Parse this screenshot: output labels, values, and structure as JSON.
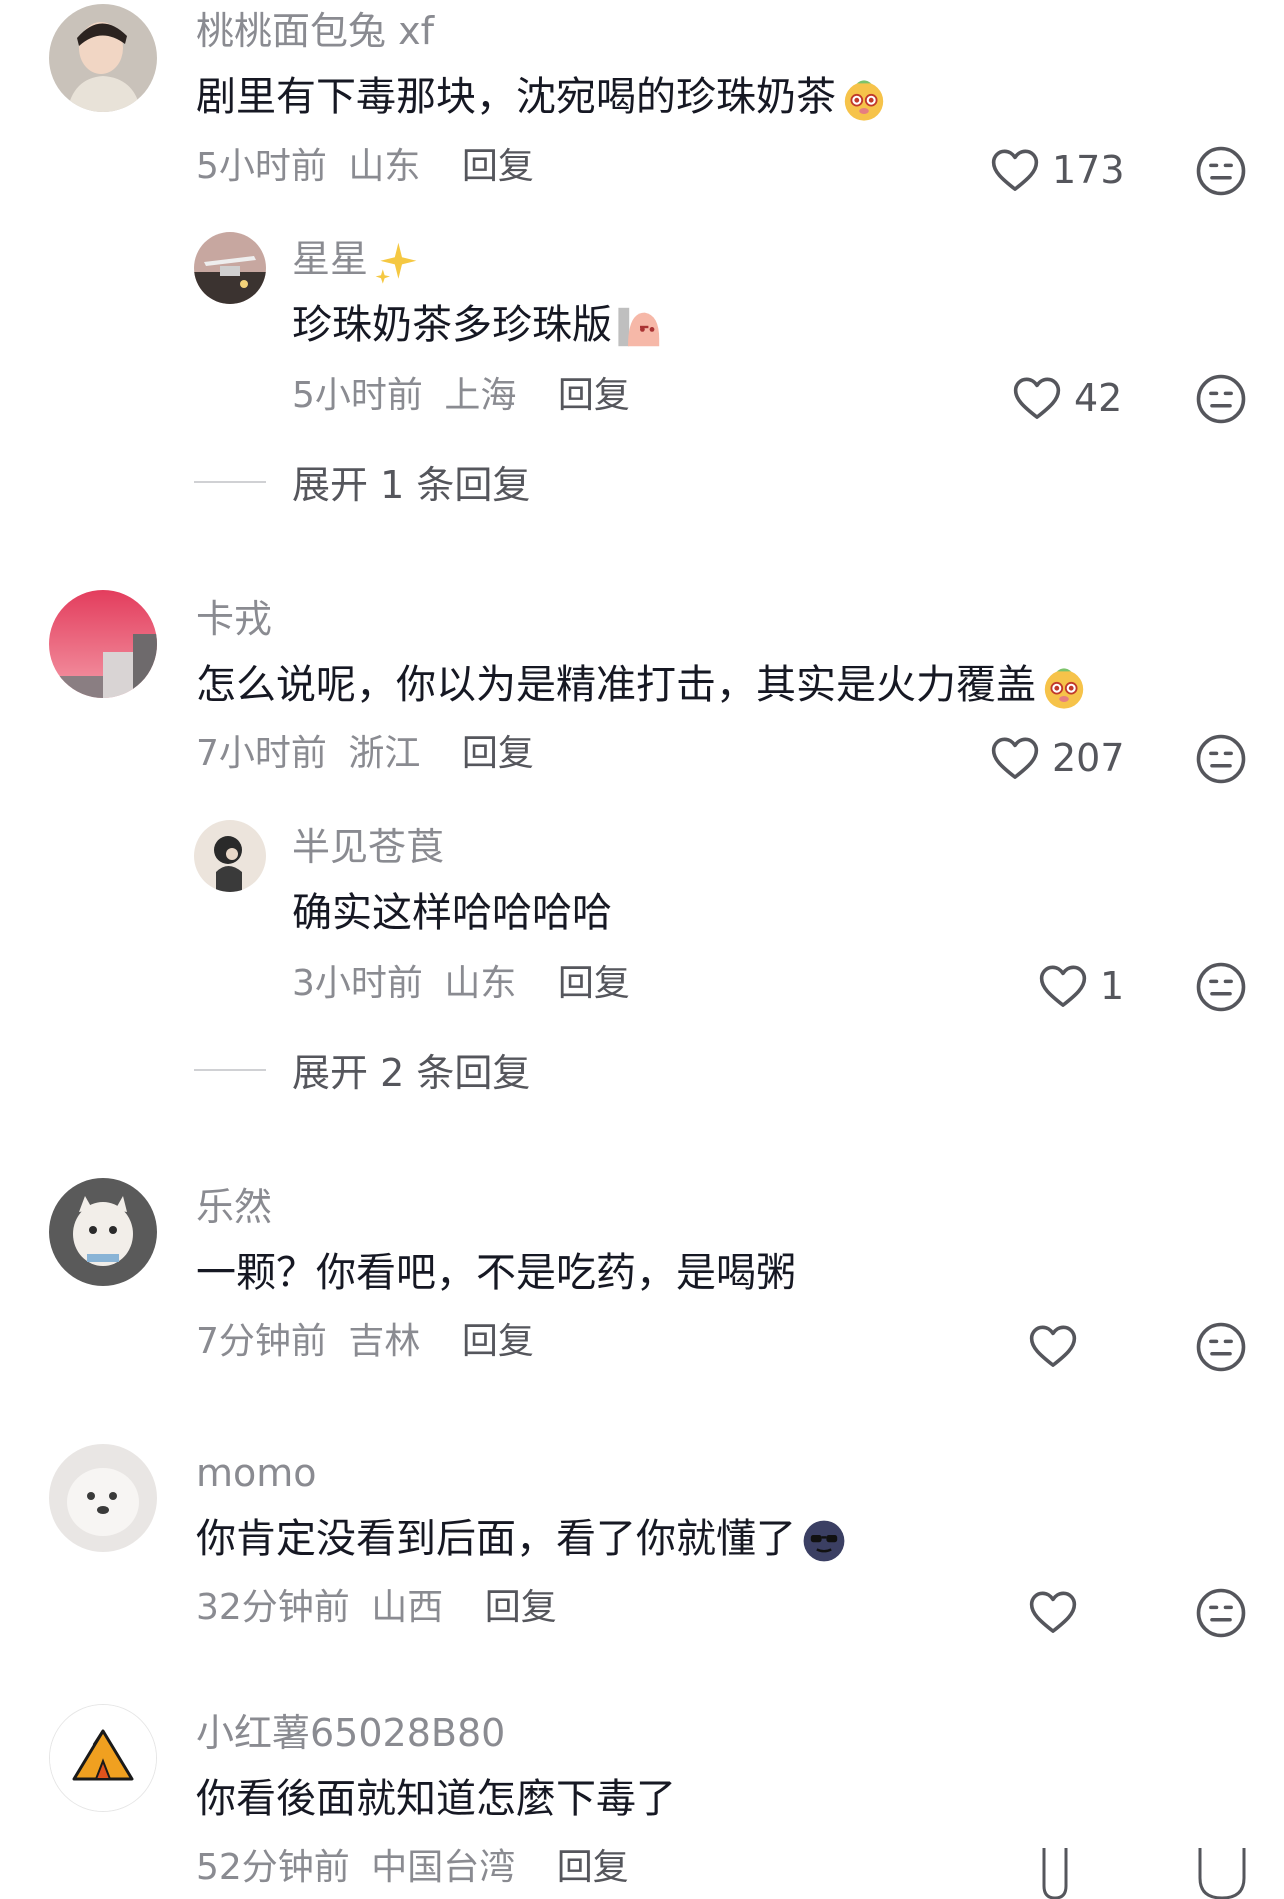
{
  "comments": [
    {
      "name": "桃桃面包兔 xf",
      "text": "剧里有下毒那块，沈宛喝的珍珠奶茶",
      "emoji": "dog-face-emoji",
      "time": "5小时前",
      "location": "山东",
      "reply": "回复",
      "likes": "173",
      "subreply": {
        "name": "星星",
        "name_emoji": "sparkles-emoji",
        "text": "珍珠奶茶多珍珠版",
        "emoji": "peeking-bean-emoji",
        "time": "5小时前",
        "location": "上海",
        "reply": "回复",
        "likes": "42"
      },
      "expand": "展开 1 条回复"
    },
    {
      "name": "卡戎",
      "text": "怎么说呢，你以为是精准打击，其实是火力覆盖",
      "emoji": "dog-face-emoji",
      "time": "7小时前",
      "location": "浙江",
      "reply": "回复",
      "likes": "207",
      "subreply": {
        "name": "半见苍莨",
        "text": "确实这样哈哈哈哈",
        "time": "3小时前",
        "location": "山东",
        "reply": "回复",
        "likes": "1"
      },
      "expand": "展开 2 条回复"
    },
    {
      "name": "乐然",
      "text": "一颗？你看吧，不是吃药，是喝粥",
      "time": "7分钟前",
      "location": "吉林",
      "reply": "回复",
      "likes": ""
    },
    {
      "name": "momo",
      "text": "你肯定没看到后面，看了你就懂了",
      "emoji": "dark-moon-face-emoji",
      "time": "32分钟前",
      "location": "山西",
      "reply": "回复",
      "likes": ""
    },
    {
      "name": "小红薯65028B80",
      "text": "你看後面就知道怎麼下毒了",
      "time": "52分钟前",
      "location": "中国台湾",
      "reply": "回复"
    }
  ],
  "icons": {
    "like": "heart-outline-icon",
    "dislike": "neutral-face-icon"
  },
  "colors": {
    "text_primary": "#161823",
    "text_secondary": "#8a8b91",
    "reply": "#55565c"
  }
}
